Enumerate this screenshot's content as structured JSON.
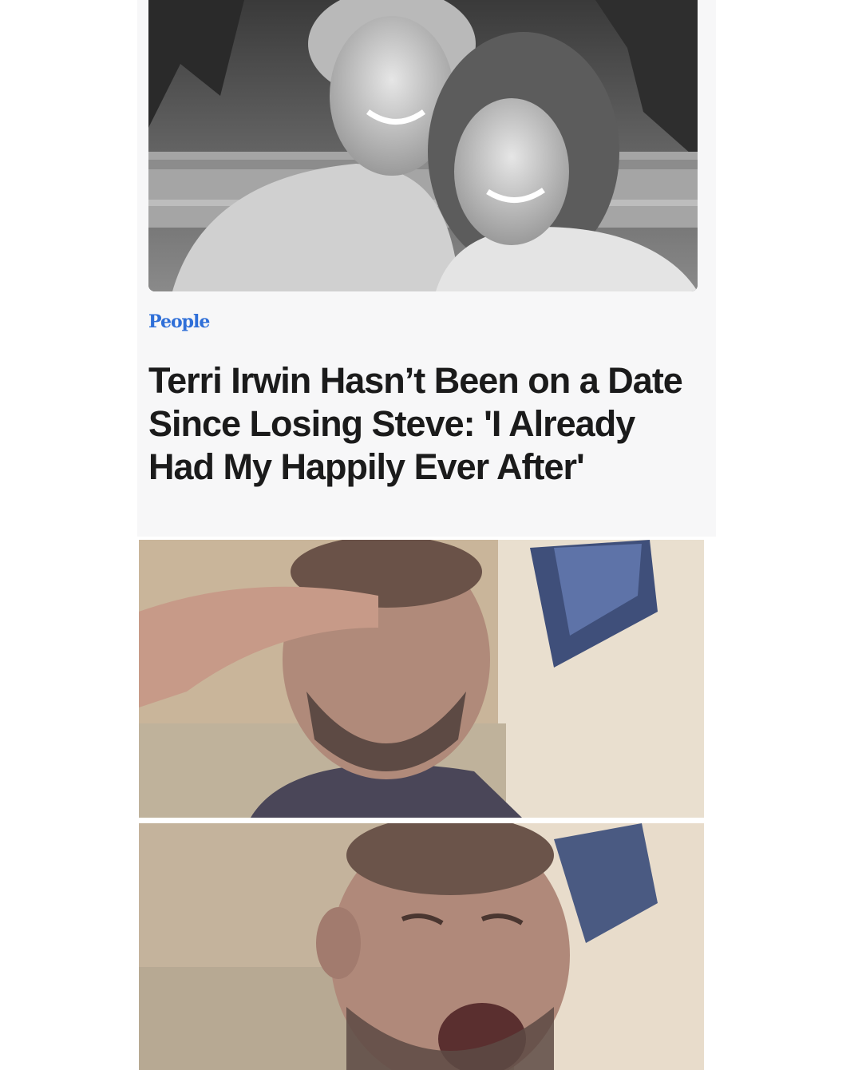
{
  "article": {
    "source": "People",
    "headline": "Terri Irwin Hasn’t Been on a Date Since Losing Steve: 'I Already Had My Happily Ever After'"
  },
  "images": {
    "top_photo": "black-and-white photo of a smiling couple embracing",
    "reaction_panel_1": "man saluting with tears",
    "reaction_panel_2": "man crying with mouth open"
  },
  "colors": {
    "brand": "#2f6fd8",
    "headline": "#1b1b1b",
    "card_background": "#f7f7f8",
    "page_background": "#ffffff"
  }
}
